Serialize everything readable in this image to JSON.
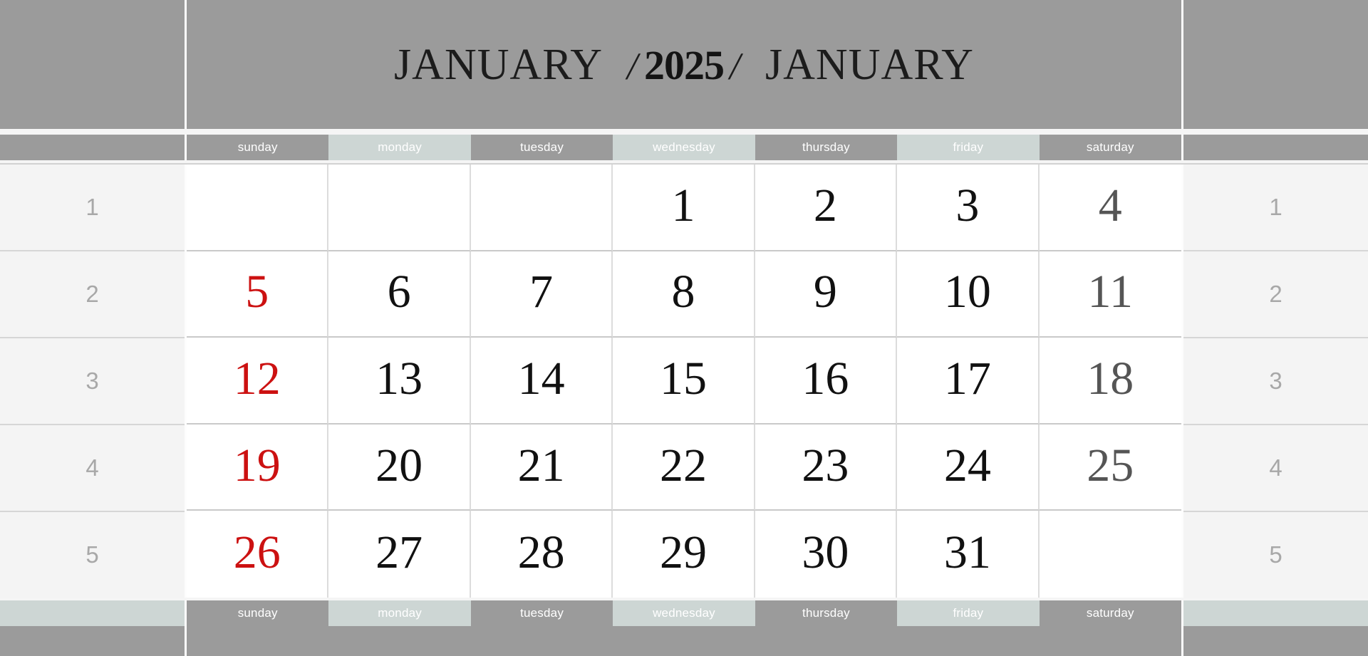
{
  "header": {
    "month_left": "JANUARY",
    "slash_left": "/",
    "year": "2025",
    "slash_right": "/",
    "month_right": "JANUARY"
  },
  "weekdays": [
    "sunday",
    "monday",
    "tuesday",
    "wednesday",
    "thursday",
    "friday",
    "saturday"
  ],
  "week_numbers_left": [
    "1",
    "2",
    "3",
    "4",
    "5"
  ],
  "week_numbers_right": [
    "1",
    "2",
    "3",
    "4",
    "5"
  ],
  "grid": {
    "rows": [
      [
        "",
        "",
        "",
        "1",
        "2",
        "3",
        "4"
      ],
      [
        "5",
        "6",
        "7",
        "8",
        "9",
        "10",
        "11"
      ],
      [
        "12",
        "13",
        "14",
        "15",
        "16",
        "17",
        "18"
      ],
      [
        "19",
        "20",
        "21",
        "22",
        "23",
        "24",
        "25"
      ],
      [
        "26",
        "27",
        "28",
        "29",
        "30",
        "31",
        ""
      ]
    ]
  },
  "colors": {
    "band_gray": "#9b9b9b",
    "pale_green": "#cdd6d4",
    "weeknum_bg": "#f4f4f4",
    "weeknum_text": "#a8a8a8",
    "sunday_red": "#cc1111",
    "saturday_gray": "#555555",
    "weekday_text": "#111111",
    "cell_bg": "#ffffff",
    "grid_line": "#dcdcdc"
  }
}
